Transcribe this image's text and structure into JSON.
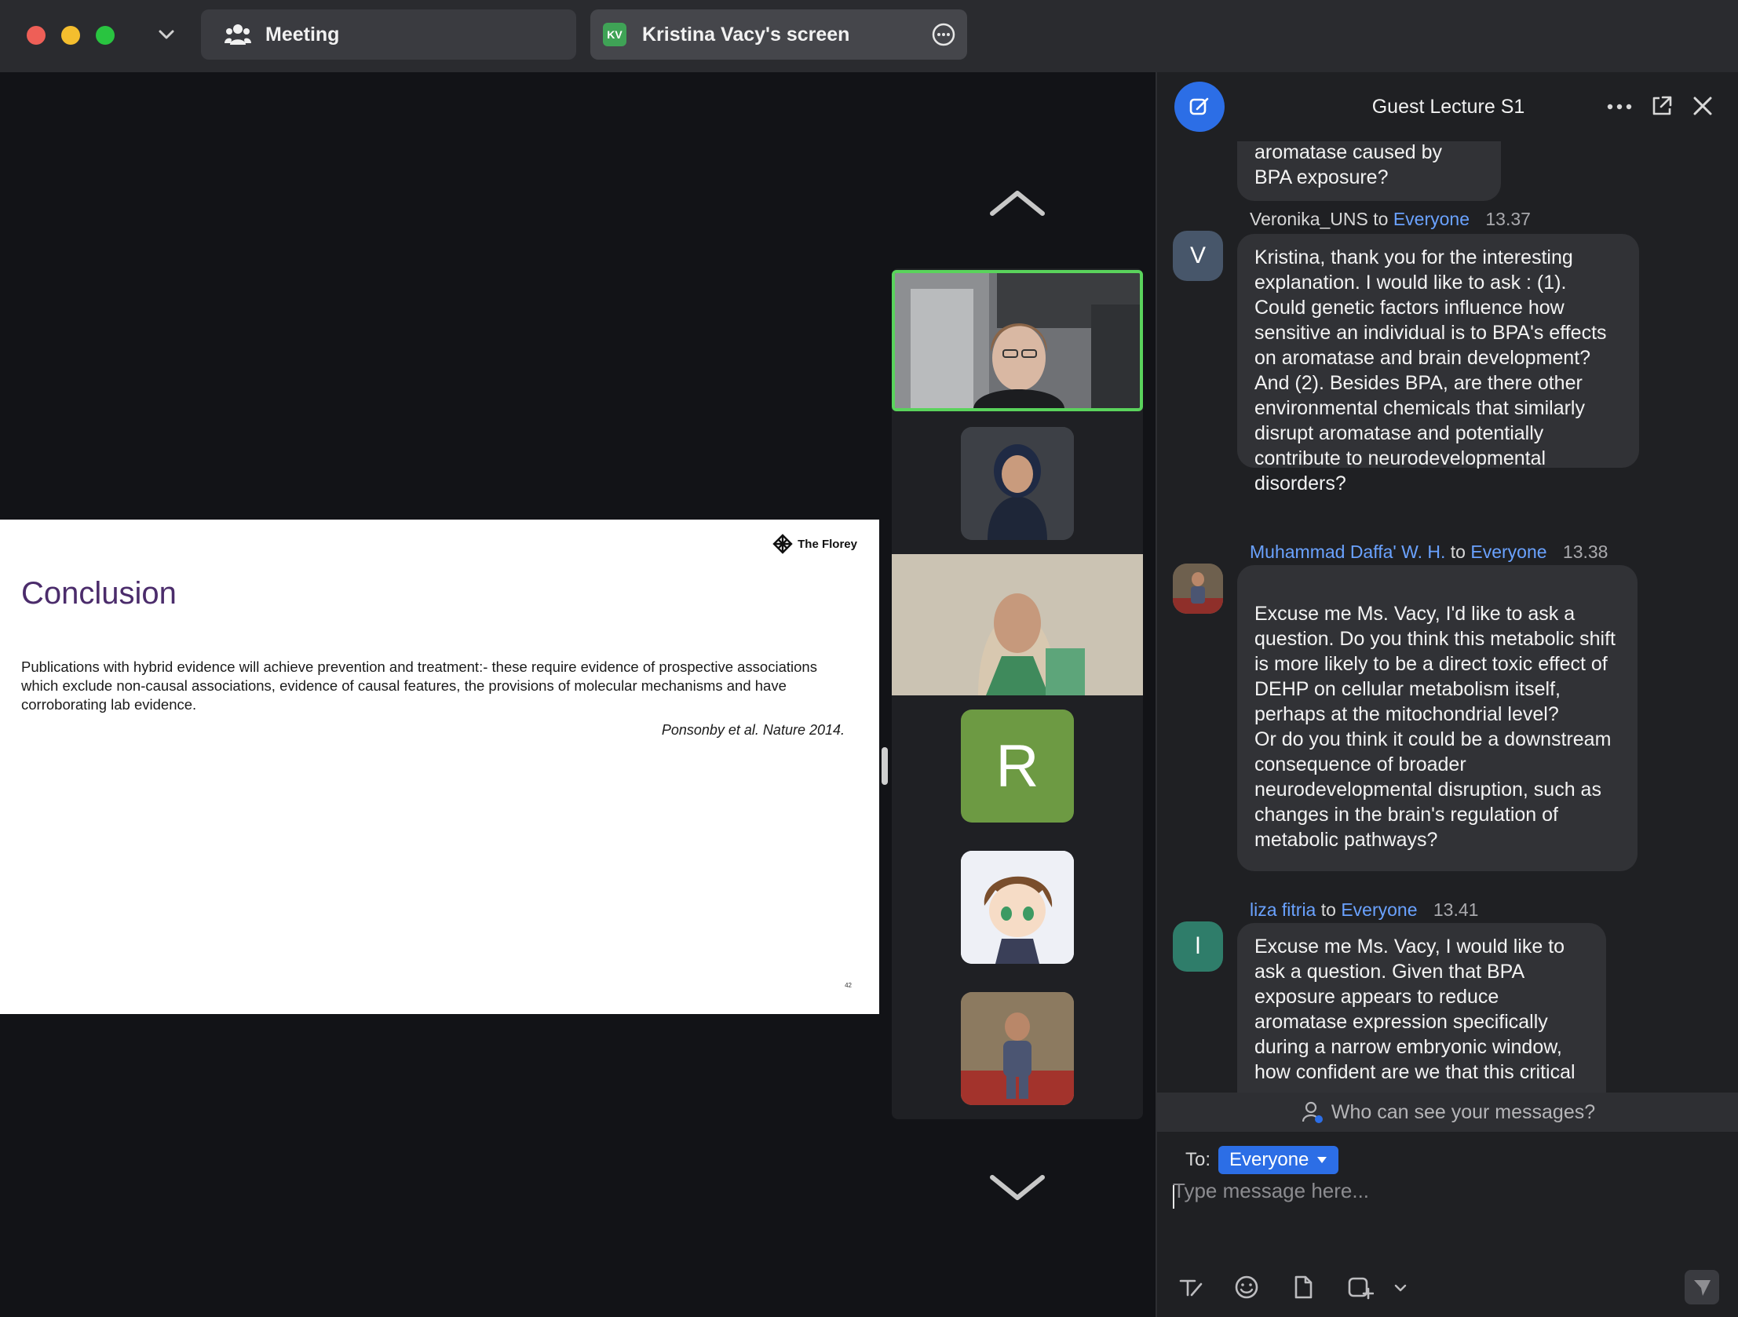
{
  "titlebar": {
    "meeting_tab": "Meeting",
    "screen_badge": "KV",
    "screen_tab": "Kristina Vacy's screen"
  },
  "slide": {
    "logo": "The Florey",
    "title": "Conclusion",
    "body": "Publications with hybrid evidence will achieve prevention and treatment:-  these require evidence of prospective associations which exclude non-causal associations, evidence of causal features, the provisions of molecular mechanisms and have corroborating lab evidence.",
    "citation": "Ponsonby et al. Nature 2014.",
    "page_number": "42"
  },
  "gallery": {
    "tiles": [
      {
        "kind": "video",
        "active_speaker": true
      },
      {
        "kind": "photo"
      },
      {
        "kind": "video"
      },
      {
        "kind": "initial",
        "initial": "R"
      },
      {
        "kind": "photo"
      },
      {
        "kind": "photo"
      }
    ]
  },
  "chat": {
    "title": "Guest Lecture S1",
    "messages": [
      {
        "partial": true,
        "text": "aromatase caused by BPA exposure?"
      },
      {
        "sender": "Veronika_UNS",
        "to_word": "to",
        "recipient": "Everyone",
        "time": "13.37",
        "avatar_initial": "V",
        "avatar_color": "#47566a",
        "text": "Kristina, thank you for the interesting explanation. I would like to ask : (1). Could genetic factors influence how sensitive an individual is to BPA's effects on aromatase and brain development? And (2). Besides BPA, are there other environmental chemicals that similarly disrupt aromatase and potentially contribute to neurodevelopmental disorders?"
      },
      {
        "sender": "Muhammad Daffa' W. H.",
        "to_word": "to",
        "recipient": "Everyone",
        "time": "13.38",
        "avatar_photo": true,
        "text": "Excuse me Ms. Vacy, I'd like to ask a question. Do you think this metabolic shift is more likely to be a direct toxic effect of DEHP on cellular metabolism itself, perhaps at the mitochondrial level?\nOr do you think it could be a downstream consequence of broader neurodevelopmental disruption, such as changes in the brain's regulation of metabolic pathways?"
      },
      {
        "sender": "liza fitria",
        "to_word": "to",
        "recipient": "Everyone",
        "time": "13.41",
        "avatar_initial": "l",
        "avatar_color": "#2f7d6a",
        "text": "Excuse me Ms. Vacy, I would like to ask a question. Given that BPA exposure appears to reduce aromatase expression specifically during a narrow embryonic window, how confident are we that this critical"
      }
    ],
    "privacy_text": "Who can see your messages?",
    "to_label": "To:",
    "to_value": "Everyone",
    "input_placeholder": "Type message here..."
  },
  "colors": {
    "accent": "#2c6ee6",
    "active_speaker": "#5ad35c",
    "link": "#6aa2ff"
  }
}
